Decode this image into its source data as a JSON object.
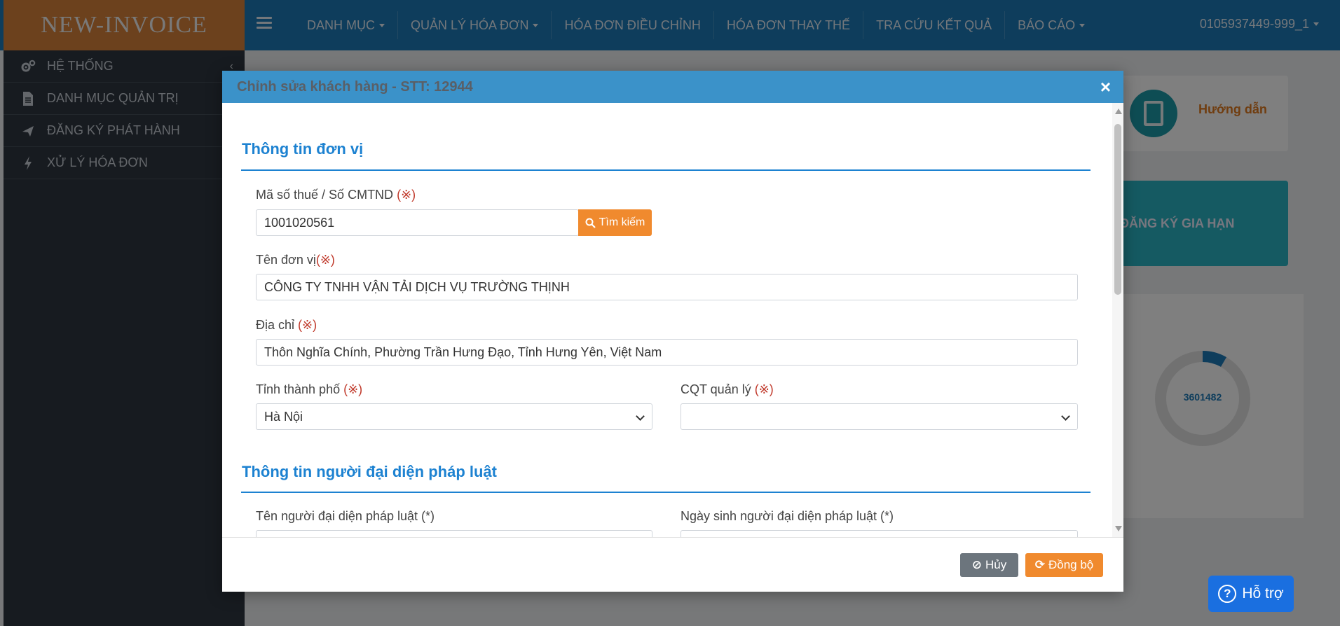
{
  "app": {
    "brand": "NEW-INVOICE"
  },
  "topnav": {
    "items": [
      {
        "label": "DANH MỤC"
      },
      {
        "label": "QUẢN LÝ HÓA ĐƠN"
      },
      {
        "label": "HÓA ĐƠN ĐIỀU CHỈNH"
      },
      {
        "label": "HÓA ĐƠN THAY THẾ"
      },
      {
        "label": "TRA CỨU KẾT QUẢ"
      },
      {
        "label": "BÁO CÁO"
      }
    ],
    "user": "0105937449-999_1"
  },
  "sidebar": {
    "items": [
      {
        "label": "HỆ THỐNG",
        "icon": "gears-icon"
      },
      {
        "label": "DANH MỤC QUẢN TRỊ",
        "icon": "document-icon"
      },
      {
        "label": "ĐĂNG KÝ PHÁT HÀNH",
        "icon": "plane-icon"
      },
      {
        "label": "XỬ LÝ HÓA ĐƠN",
        "icon": "bolt-icon"
      }
    ]
  },
  "background": {
    "help_label": "Hướng dẫn",
    "renew_label": "ĐĂNG KÝ GIA HẠN",
    "donut_value": "3601482"
  },
  "modal": {
    "title": "Chỉnh sửa khách hàng - STT: 12944",
    "close_glyph": "×",
    "required_mark": "(※)",
    "section1_title": "Thông tin đơn vị",
    "tax_label": "Mã số thuế / Số CMTND",
    "tax_value": "1001020561",
    "search_button": "Tìm kiếm",
    "name_label": "Tên đơn vị",
    "name_value": "CÔNG TY TNHH VẬN TẢI DỊCH VỤ TRƯỜNG THỊNH",
    "address_label": "Địa chỉ",
    "address_value": "Thôn Nghĩa Chính, Phường Trần Hưng Đạo, Tỉnh Hưng Yên, Việt Nam",
    "province_label": "Tỉnh thành phố",
    "province_value": "Hà Nội",
    "tax_office_label": "CQT quản lý",
    "tax_office_value": "",
    "section2_title": "Thông tin người đại diện pháp luật",
    "rep_name_label": "Tên người đại diện pháp luật (*)",
    "rep_dob_label": "Ngày sinh người đại diện pháp luật (*)",
    "cancel_button": "Hủy",
    "sync_button": "Đồng bộ"
  },
  "support": {
    "label": "Hỗ trợ",
    "icon": "question-icon"
  },
  "colors": {
    "topbar": "#1c7ab8",
    "brand_bg": "#d9823a",
    "sidebar": "#2e3741",
    "accent_blue": "#1d82d1",
    "accent_orange": "#f08a2e",
    "support_blue": "#1a6fe0"
  }
}
